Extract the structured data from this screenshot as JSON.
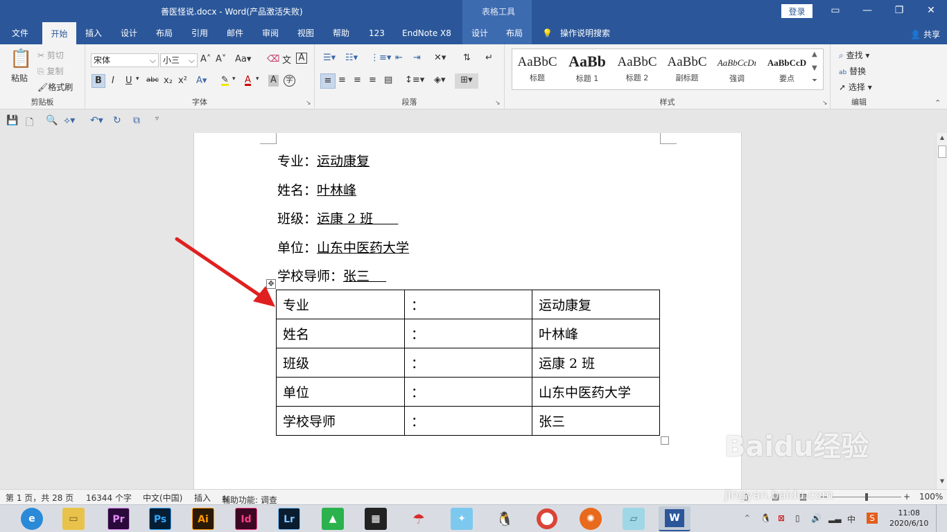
{
  "titlebar": {
    "title": "善医怪说.docx  -  Word(产品激活失败)",
    "context_tab": "表格工具",
    "login": "登录",
    "window_buttons": [
      "restore-ribbon",
      "minimize",
      "maximize",
      "close"
    ]
  },
  "tabs": [
    {
      "label": "文件"
    },
    {
      "label": "开始"
    },
    {
      "label": "插入"
    },
    {
      "label": "设计"
    },
    {
      "label": "布局"
    },
    {
      "label": "引用"
    },
    {
      "label": "邮件"
    },
    {
      "label": "审阅"
    },
    {
      "label": "视图"
    },
    {
      "label": "帮助"
    },
    {
      "label": "123"
    },
    {
      "label": "EndNote X8"
    },
    {
      "label": "设计"
    },
    {
      "label": "布局"
    }
  ],
  "tell_me": "操作说明搜索",
  "share": "共享",
  "ribbon": {
    "clipboard": {
      "paste": "粘贴",
      "cut": "剪切",
      "copy": "复制",
      "format_painter": "格式刷",
      "label": "剪贴板"
    },
    "font": {
      "name": "宋体",
      "size": "小三",
      "label": "字体",
      "case": "Aa",
      "bold": "B",
      "italic": "I",
      "underline": "U",
      "strike": "abc",
      "sub": "x₂",
      "sup": "x²",
      "color_a": "A",
      "char_shade": "A",
      "circle": "字"
    },
    "paragraph": {
      "label": "段落"
    },
    "styles": {
      "label": "样式",
      "items": [
        {
          "sample": "AaBbC",
          "name": "标题"
        },
        {
          "sample": "AaBb",
          "name": "标题 1"
        },
        {
          "sample": "AaBbC",
          "name": "标题 2"
        },
        {
          "sample": "AaBbC",
          "name": "副标题"
        },
        {
          "sample": "AaBbCcDı",
          "name": "强调"
        },
        {
          "sample": "AaBbCcD",
          "name": "要点"
        }
      ]
    },
    "editing": {
      "find": "查找",
      "replace": "替换",
      "select": "选择",
      "label": "编辑"
    }
  },
  "document": {
    "lines": [
      {
        "label": "专业：",
        "value": "运动康复"
      },
      {
        "label": "姓名：",
        "value": "叶林峰"
      },
      {
        "label": "班级：",
        "value": "运康 2 班      "
      },
      {
        "label": "单位：",
        "value": "山东中医药大学"
      },
      {
        "label": "学校导师：",
        "value": "张三    "
      }
    ],
    "table": [
      [
        "专业",
        "：",
        "运动康复"
      ],
      [
        "姓名",
        "：",
        "叶林峰"
      ],
      [
        "班级",
        "：",
        "运康 2 班"
      ],
      [
        "单位",
        "：",
        "山东中医药大学"
      ],
      [
        "学校导师",
        "：",
        "张三"
      ]
    ]
  },
  "status": {
    "page": "第 1 页，共 28 页",
    "words": "16344 个字",
    "lang": "中文(中国)",
    "mode": "插入",
    "accessibility": "辅助功能: 调查",
    "zoom": "100%"
  },
  "taskbar": {
    "apps": [
      "edge",
      "explorer",
      "Pr",
      "Ps",
      "Ai",
      "Id",
      "Lr",
      "greenapp",
      "video",
      "umbrella",
      "qq-bird",
      "qq",
      "chrome",
      "fox",
      "notes",
      "W"
    ],
    "ime": "中",
    "time": "11:08",
    "date": "2020/6/10"
  },
  "watermark": {
    "main": "Baidu经验",
    "sub": "jingyan.baidu.com"
  },
  "colors": {
    "word_blue": "#2b579a",
    "arrow": "#e02020"
  }
}
